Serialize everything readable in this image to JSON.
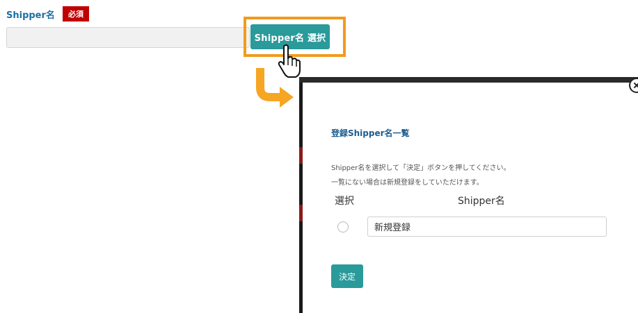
{
  "form": {
    "label": "Shipper名",
    "required_badge": "必須",
    "input_value": "",
    "select_button_label": "Shipper名 選択"
  },
  "modal": {
    "title": "登録Shipper名一覧",
    "instruction_line1": "Shipper名を選択して「決定」ボタンを押してください。",
    "instruction_line2": "一覧にない場合は新規登録をしていただけます。",
    "column_select": "選択",
    "column_shipper": "Shipper名",
    "rows": [
      {
        "name": "新規登録",
        "selected": false
      }
    ],
    "decide_button_label": "決定"
  },
  "colors": {
    "accent": "#2a9a9b",
    "highlight": "#f29b1d",
    "required": "#c00000",
    "label": "#1d6fa5"
  },
  "icons": [
    "hand-pointer-icon",
    "curved-arrow-icon",
    "close-icon"
  ]
}
